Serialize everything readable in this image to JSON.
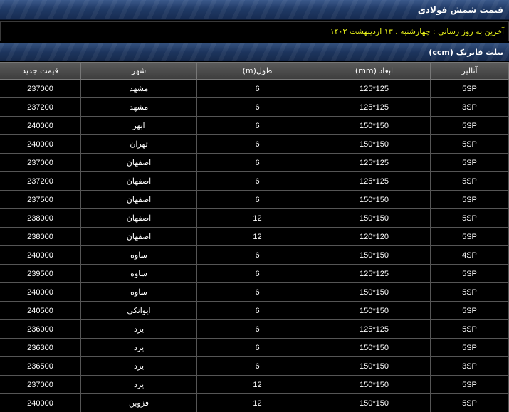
{
  "header": {
    "title": "قیمت شمش فولادی",
    "last_update": "آخرین به روز رسانی : چهارشنبه ، ۱۳  اردیبهشت ۱۴۰۲",
    "section_title": "بیلت فابریک (ccm)"
  },
  "table": {
    "columns": [
      "آنالیز",
      "ابعاد (mm)",
      "طول(m)",
      "شهر",
      "قیمت جدید"
    ],
    "rows": [
      {
        "analysis": "5SP",
        "dimensions": "125*125",
        "length": "6",
        "city": "مشهد",
        "price": "237000"
      },
      {
        "analysis": "3SP",
        "dimensions": "125*125",
        "length": "6",
        "city": "مشهد",
        "price": "237200"
      },
      {
        "analysis": "5SP",
        "dimensions": "150*150",
        "length": "6",
        "city": "ابهر",
        "price": "240000"
      },
      {
        "analysis": "5SP",
        "dimensions": "150*150",
        "length": "6",
        "city": "تهران",
        "price": "240000"
      },
      {
        "analysis": "5SP",
        "dimensions": "125*125",
        "length": "6",
        "city": "اصفهان",
        "price": "237000"
      },
      {
        "analysis": "5SP",
        "dimensions": "125*125",
        "length": "6",
        "city": "اصفهان",
        "price": "237200"
      },
      {
        "analysis": "5SP",
        "dimensions": "150*150",
        "length": "6",
        "city": "اصفهان",
        "price": "237500"
      },
      {
        "analysis": "5SP",
        "dimensions": "150*150",
        "length": "12",
        "city": "اصفهان",
        "price": "238000"
      },
      {
        "analysis": "5SP",
        "dimensions": "120*120",
        "length": "12",
        "city": "اصفهان",
        "price": "238000"
      },
      {
        "analysis": "4SP",
        "dimensions": "150*150",
        "length": "6",
        "city": "ساوه",
        "price": "240000"
      },
      {
        "analysis": "5SP",
        "dimensions": "125*125",
        "length": "6",
        "city": "ساوه",
        "price": "239500"
      },
      {
        "analysis": "5SP",
        "dimensions": "150*150",
        "length": "6",
        "city": "ساوه",
        "price": "240000"
      },
      {
        "analysis": "5SP",
        "dimensions": "150*150",
        "length": "6",
        "city": "ایوانکی",
        "price": "240500"
      },
      {
        "analysis": "5SP",
        "dimensions": "125*125",
        "length": "6",
        "city": "یزد",
        "price": "236000"
      },
      {
        "analysis": "5SP",
        "dimensions": "150*150",
        "length": "6",
        "city": "یزد",
        "price": "236300"
      },
      {
        "analysis": "3SP",
        "dimensions": "150*150",
        "length": "6",
        "city": "یزد",
        "price": "236500"
      },
      {
        "analysis": "5SP",
        "dimensions": "150*150",
        "length": "12",
        "city": "یزد",
        "price": "237000"
      },
      {
        "analysis": "5SP",
        "dimensions": "150*150",
        "length": "12",
        "city": "قزوین",
        "price": "240000"
      }
    ]
  }
}
